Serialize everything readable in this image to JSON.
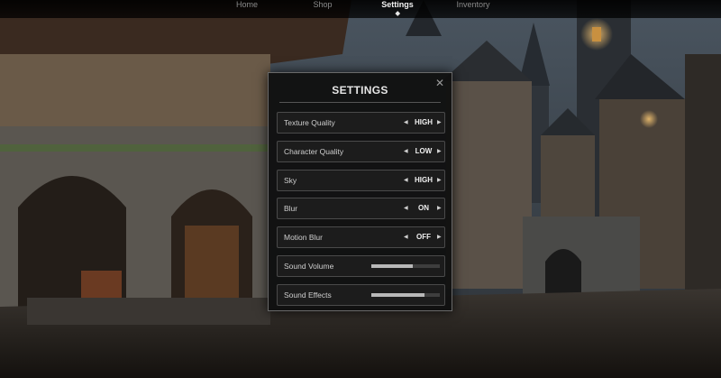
{
  "nav": {
    "items": [
      {
        "label": "Home",
        "active": false
      },
      {
        "label": "Shop",
        "active": false
      },
      {
        "label": "Settings",
        "active": true
      },
      {
        "label": "Inventory",
        "active": false
      }
    ]
  },
  "settings": {
    "title": "SETTINGS",
    "close_icon": "close-icon",
    "options": [
      {
        "label": "Texture Quality",
        "value": "HIGH"
      },
      {
        "label": "Character Quality",
        "value": "LOW"
      },
      {
        "label": "Sky",
        "value": "HIGH"
      },
      {
        "label": "Blur",
        "value": "ON"
      },
      {
        "label": "Motion Blur",
        "value": "OFF"
      }
    ],
    "sliders": [
      {
        "label": "Sound Volume",
        "level": 0.6
      },
      {
        "label": "Sound Effects",
        "level": 0.77
      }
    ]
  },
  "colors": {
    "panel_bg": "#101010",
    "panel_border": "#6a6a6a",
    "accent_text": "#f0f0f0",
    "slider_fill": "#b8b8b8"
  }
}
